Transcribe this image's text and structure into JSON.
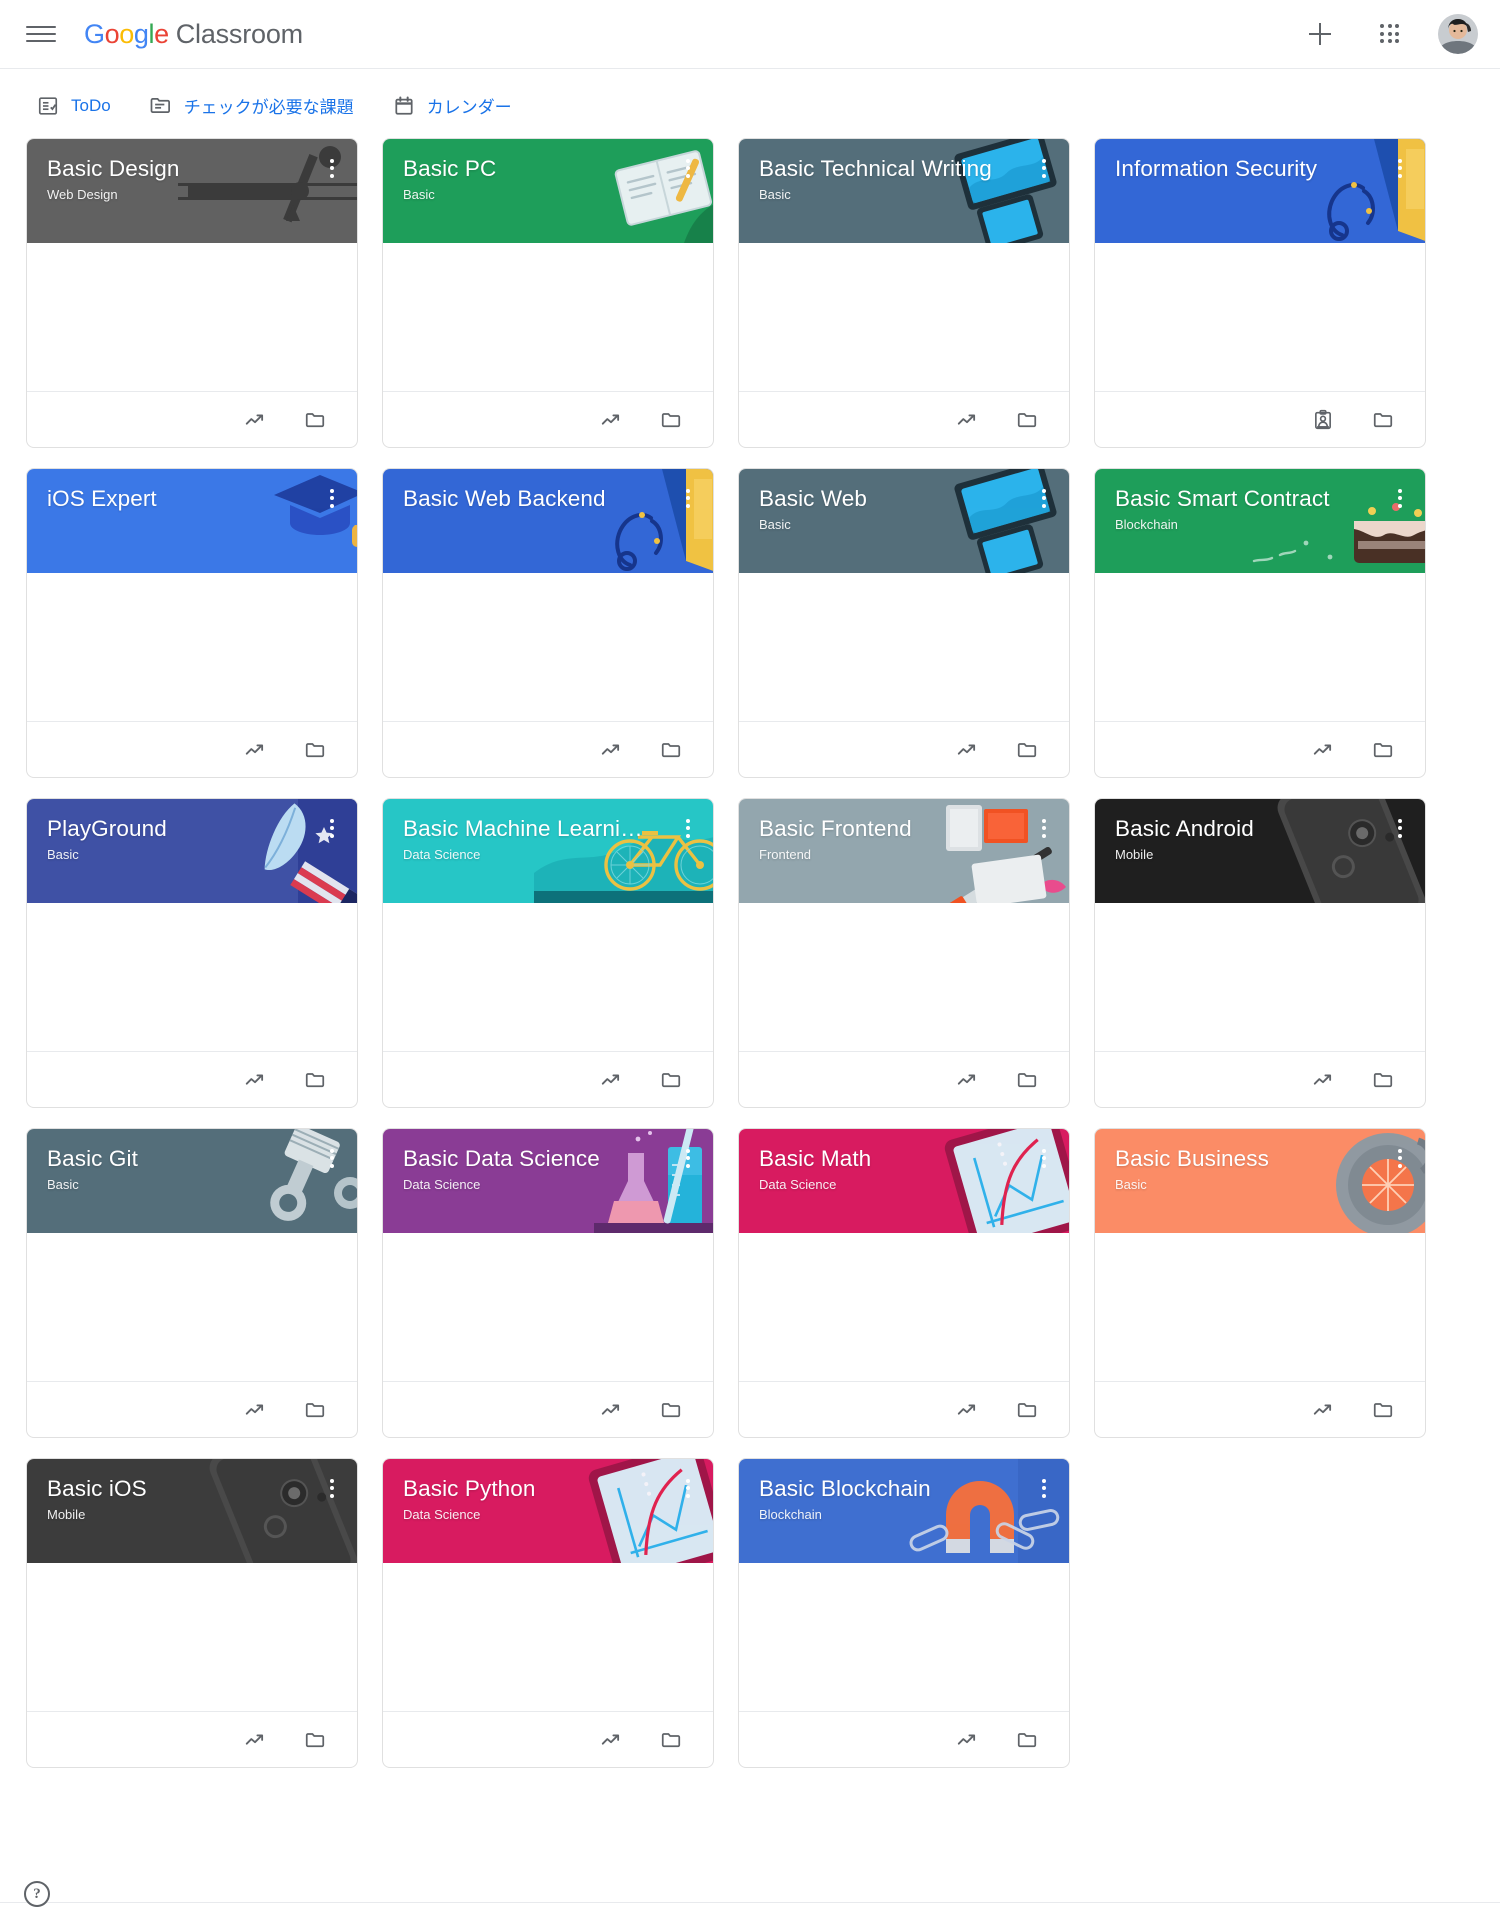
{
  "appbar": {
    "menu_label": "Main menu",
    "logo_letters": [
      "G",
      "o",
      "o",
      "g",
      "l",
      "e"
    ],
    "product_name": "Classroom",
    "create_label": "Create or join class",
    "apps_label": "Google apps",
    "account_label": "Google Account"
  },
  "quicklinks": [
    {
      "label": "ToDo",
      "icon": "todo-list-icon"
    },
    {
      "label": "チェックが必要な課題",
      "icon": "review-work-icon"
    },
    {
      "label": "カレンダー",
      "icon": "calendar-icon"
    }
  ],
  "footer": {
    "help_label": "?"
  },
  "colors": {
    "link": "#1a73e8",
    "icon": "#5f6368",
    "card_border": "#e0e0e0"
  },
  "cards": [
    {
      "title": "Basic Design",
      "subtitle": "Web Design",
      "color": "#616161",
      "art": "ruler",
      "actions": [
        "trending-up-icon",
        "folder-icon"
      ]
    },
    {
      "title": "Basic PC",
      "subtitle": "Basic",
      "color": "#1E9E5A",
      "art": "book",
      "actions": [
        "trending-up-icon",
        "folder-icon"
      ]
    },
    {
      "title": "Basic Technical Writing",
      "subtitle": "Basic",
      "color": "#546E7A",
      "art": "devices",
      "actions": [
        "trending-up-icon",
        "folder-icon"
      ]
    },
    {
      "title": "Information Security",
      "subtitle": "",
      "color": "#3367D6",
      "art": "headphones",
      "actions": [
        "assignment-person-icon",
        "folder-icon"
      ]
    },
    {
      "title": "iOS Expert",
      "subtitle": "",
      "color": "#3B78E7",
      "art": "graduation",
      "actions": [
        "trending-up-icon",
        "folder-icon"
      ]
    },
    {
      "title": "Basic Web Backend",
      "subtitle": "",
      "color": "#3367D6",
      "art": "headphones",
      "actions": [
        "trending-up-icon",
        "folder-icon"
      ]
    },
    {
      "title": "Basic Web",
      "subtitle": "Basic",
      "color": "#546E7A",
      "art": "devices",
      "actions": [
        "trending-up-icon",
        "folder-icon"
      ]
    },
    {
      "title": "Basic Smart Contract",
      "subtitle": "Blockchain",
      "color": "#1E9E5A",
      "art": "cake",
      "actions": [
        "trending-up-icon",
        "folder-icon"
      ]
    },
    {
      "title": "PlayGround",
      "subtitle": "Basic",
      "color": "#3F51A5",
      "art": "feather",
      "actions": [
        "trending-up-icon",
        "folder-icon"
      ]
    },
    {
      "title": "Basic Machine Learni…",
      "subtitle": "Data Science",
      "color": "#26C6C6",
      "art": "bicycle",
      "actions": [
        "trending-up-icon",
        "folder-icon"
      ]
    },
    {
      "title": "Basic Frontend",
      "subtitle": "Frontend",
      "color": "#93A6AE",
      "art": "paint",
      "actions": [
        "trending-up-icon",
        "folder-icon"
      ]
    },
    {
      "title": "Basic Android",
      "subtitle": "Mobile",
      "color": "#1F1F1F",
      "art": "phone",
      "actions": [
        "trending-up-icon",
        "folder-icon"
      ]
    },
    {
      "title": "Basic Git",
      "subtitle": "Basic",
      "color": "#546E7A",
      "art": "piston",
      "actions": [
        "trending-up-icon",
        "folder-icon"
      ]
    },
    {
      "title": "Basic Data Science",
      "subtitle": "Data Science",
      "color": "#8A3C95",
      "art": "flask",
      "actions": [
        "trending-up-icon",
        "folder-icon"
      ]
    },
    {
      "title": "Basic Math",
      "subtitle": "Data Science",
      "color": "#D81B60",
      "art": "tablet",
      "actions": [
        "trending-up-icon",
        "folder-icon"
      ]
    },
    {
      "title": "Basic Business",
      "subtitle": "Basic",
      "color": "#FB8C66",
      "art": "coffee",
      "actions": [
        "trending-up-icon",
        "folder-icon"
      ]
    },
    {
      "title": "Basic iOS",
      "subtitle": "Mobile",
      "color": "#3C3C3C",
      "art": "phone",
      "actions": [
        "trending-up-icon",
        "folder-icon"
      ]
    },
    {
      "title": "Basic Python",
      "subtitle": "Data Science",
      "color": "#D81B60",
      "art": "tablet",
      "actions": [
        "trending-up-icon",
        "folder-icon"
      ]
    },
    {
      "title": "Basic Blockchain",
      "subtitle": "Blockchain",
      "color": "#3F6FD0",
      "art": "magnet",
      "actions": [
        "trending-up-icon",
        "folder-icon"
      ]
    }
  ]
}
